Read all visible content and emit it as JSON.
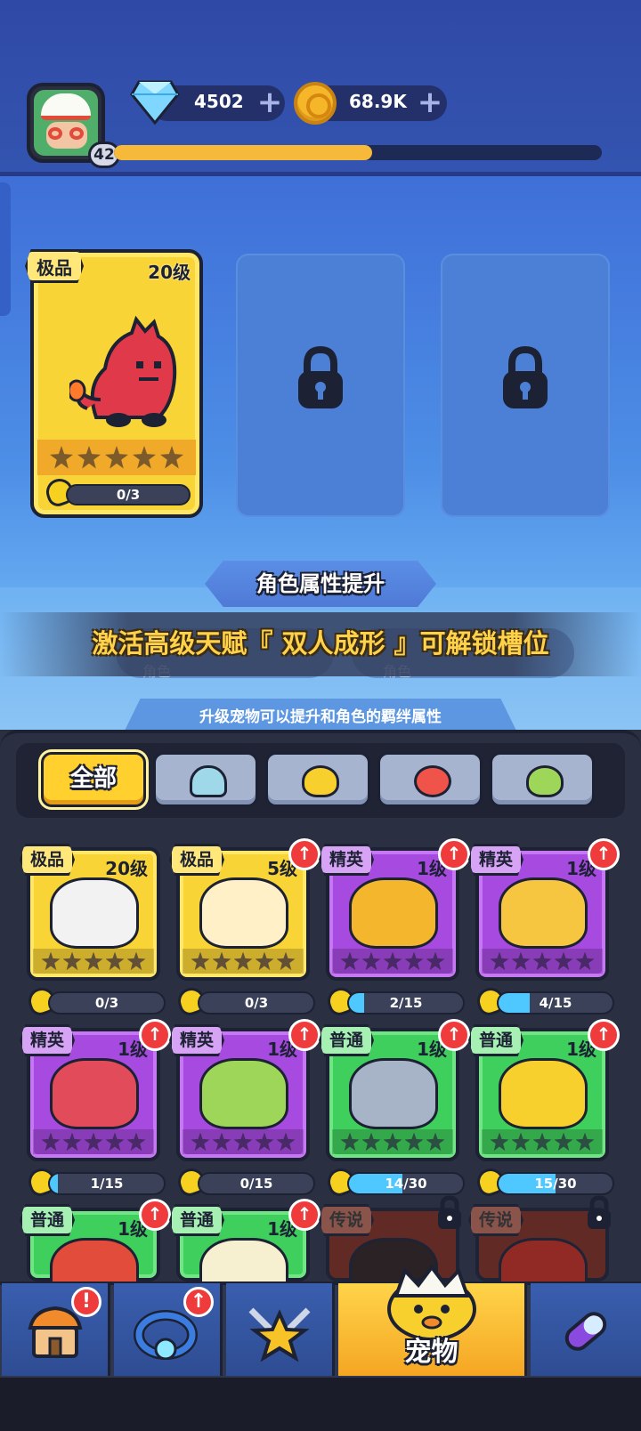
{
  "header": {
    "player_level": "42",
    "xp_progress": 0.53,
    "gems": "4502",
    "coins": "68.9K"
  },
  "slots": {
    "slot1": {
      "rarity": "极品",
      "level": "20级",
      "shards": "0/3",
      "stars": 5
    }
  },
  "banner": {
    "attr_title": "角色属性提升",
    "message": "激活高级天赋『 双人成形 』可解锁槽位",
    "ghost_label_1": "角色",
    "ghost_label_2": "角色",
    "hint": "升级宠物可以提升和角色的羁绊属性"
  },
  "filters": {
    "all_label": "全部",
    "icons": [
      "robot-icon",
      "chick-icon",
      "fish-icon",
      "plant-icon"
    ]
  },
  "pets": [
    {
      "rarity": "极品",
      "level": "20级",
      "progress": "0/3",
      "fill": 0,
      "upgrade": false,
      "tier": "legend",
      "color": "#f2f2f2"
    },
    {
      "rarity": "极品",
      "level": "5级",
      "progress": "0/3",
      "fill": 0,
      "upgrade": true,
      "tier": "legend",
      "color": "#fff0c8"
    },
    {
      "rarity": "精英",
      "level": "1级",
      "progress": "2/15",
      "fill": 0.13,
      "upgrade": true,
      "tier": "elite",
      "color": "#f4b62c"
    },
    {
      "rarity": "精英",
      "level": "1级",
      "progress": "4/15",
      "fill": 0.27,
      "upgrade": true,
      "tier": "elite",
      "color": "#f7c640"
    },
    {
      "rarity": "精英",
      "level": "1级",
      "progress": "1/15",
      "fill": 0.07,
      "upgrade": true,
      "tier": "elite",
      "color": "#e24c5a"
    },
    {
      "rarity": "精英",
      "level": "1级",
      "progress": "0/15",
      "fill": 0,
      "upgrade": true,
      "tier": "elite",
      "color": "#9ed65a"
    },
    {
      "rarity": "普通",
      "level": "1级",
      "progress": "14/30",
      "fill": 0.47,
      "upgrade": true,
      "tier": "normal",
      "color": "#a7b4c8"
    },
    {
      "rarity": "普通",
      "level": "1级",
      "progress": "15/30",
      "fill": 0.5,
      "upgrade": true,
      "tier": "normal",
      "color": "#f7d02e"
    },
    {
      "rarity": "普通",
      "level": "1级",
      "upgrade": true,
      "tier": "normal",
      "color": "#e24c3a"
    },
    {
      "rarity": "普通",
      "level": "1级",
      "upgrade": true,
      "tier": "normal",
      "color": "#f6f0d0"
    },
    {
      "rarity": "传说",
      "locked": true,
      "tier": "dark",
      "color": "#2a2020"
    },
    {
      "rarity": "传说",
      "locked": true,
      "tier": "dark",
      "color": "#a32a1f"
    }
  ],
  "nav": {
    "pet_label": "宠物",
    "shop_badge": "!",
    "ring_badge": "↑"
  }
}
